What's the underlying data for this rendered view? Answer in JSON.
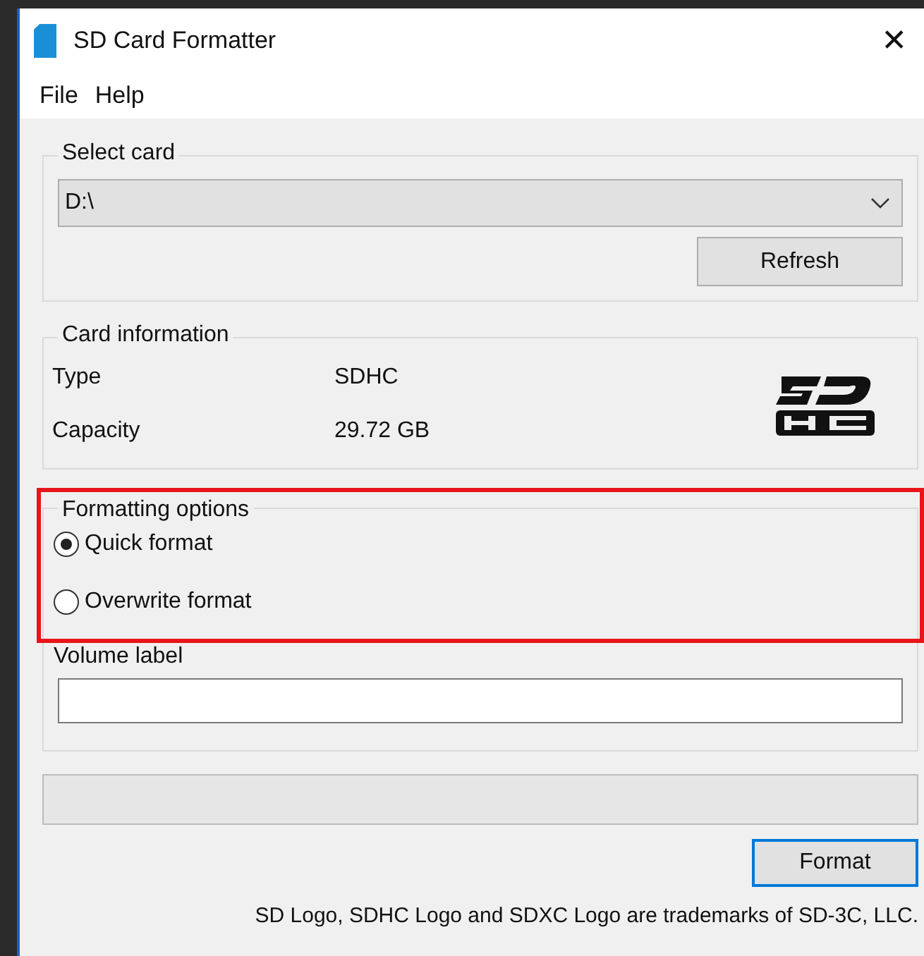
{
  "window": {
    "title": "SD Card Formatter",
    "close": "✕"
  },
  "menu": [
    {
      "label": "File"
    },
    {
      "label": "Help"
    }
  ],
  "select_card": {
    "legend": "Select card",
    "value": "D:\\",
    "refresh": "Refresh"
  },
  "card_information": {
    "legend": "Card information",
    "rows": [
      {
        "label": "Type",
        "value": "SDHC"
      },
      {
        "label": "Capacity",
        "value": "29.72 GB"
      }
    ]
  },
  "formatting_options": {
    "legend": "Formatting options",
    "highlighted": true,
    "options": [
      {
        "label": "Quick format",
        "selected": true
      },
      {
        "label": "Overwrite format",
        "selected": false
      }
    ]
  },
  "volume_label": {
    "label": "Volume label"
  },
  "progress": {
    "level": 0
  },
  "format_button": "Format",
  "footer": "SD Logo, SDHC Logo and SDXC Logo are trademarks of SD-3C, LLC."
}
